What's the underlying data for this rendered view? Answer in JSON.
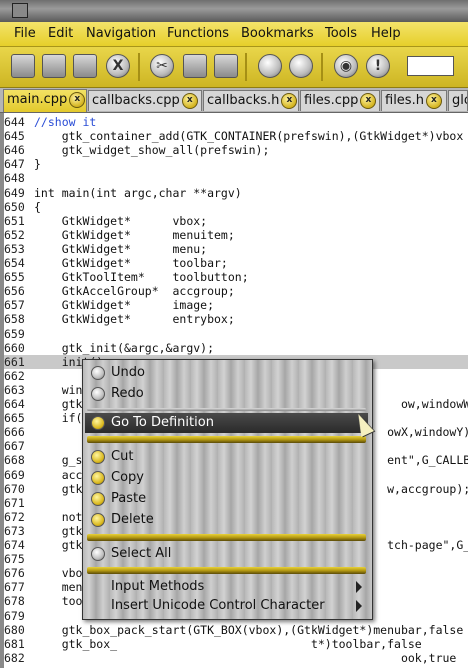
{
  "menubar": {
    "items": [
      "File",
      "Edit",
      "Navigation",
      "Functions",
      "Bookmarks",
      "Tools",
      "Help"
    ]
  },
  "toolbar": {
    "buttons": [
      "new-icon",
      "open-icon",
      "save-icon",
      "close-icon",
      "cut-icon",
      "copy-icon",
      "paste-icon",
      "back-icon",
      "forward-icon",
      "preview-icon",
      "help-icon"
    ],
    "search_value": ""
  },
  "tabs": [
    {
      "label": "main.cpp",
      "active": true
    },
    {
      "label": "callbacks.cpp",
      "active": false
    },
    {
      "label": "callbacks.h",
      "active": false
    },
    {
      "label": "files.cpp",
      "active": false
    },
    {
      "label": "files.h",
      "active": false
    },
    {
      "label": "glo",
      "active": false
    }
  ],
  "editor": {
    "current_line": "661",
    "lines": [
      {
        "n": "644",
        "t": "//show it"
      },
      {
        "n": "645",
        "t": "    gtk_container_add(GTK_CONTAINER(prefswin),(GtkWidget*)vbox"
      },
      {
        "n": "646",
        "t": "    gtk_widget_show_all(prefswin);"
      },
      {
        "n": "647",
        "t": "}"
      },
      {
        "n": "648",
        "t": ""
      },
      {
        "n": "649",
        "t": "int main(int argc,char **argv)"
      },
      {
        "n": "650",
        "t": "{"
      },
      {
        "n": "651",
        "t": "    GtkWidget*      vbox;"
      },
      {
        "n": "652",
        "t": "    GtkWidget*      menuitem;"
      },
      {
        "n": "653",
        "t": "    GtkWidget*      menu;"
      },
      {
        "n": "654",
        "t": "    GtkWidget*      toolbar;"
      },
      {
        "n": "655",
        "t": "    GtkToolItem*    toolbutton;"
      },
      {
        "n": "656",
        "t": "    GtkAccelGroup*  accgroup;"
      },
      {
        "n": "657",
        "t": "    GtkWidget*      image;"
      },
      {
        "n": "658",
        "t": "    GtkWidget*      entrybox;"
      },
      {
        "n": "659",
        "t": ""
      },
      {
        "n": "660",
        "t": "    gtk_init(&argc,&argv);"
      },
      {
        "n": "661",
        "t": "    init();"
      },
      {
        "n": "662",
        "t": ""
      },
      {
        "n": "663",
        "t": "    win"
      },
      {
        "n": "664",
        "t": "    gtk                                              ow,windowWidth"
      },
      {
        "n": "665",
        "t": "    if(                                            "
      },
      {
        "n": "666",
        "t": "                                                   owX,windowY);"
      },
      {
        "n": "667",
        "t": ""
      },
      {
        "n": "668",
        "t": "    g_s                                            ent\",G_CALLBAC"
      },
      {
        "n": "669",
        "t": "    acc"
      },
      {
        "n": "670",
        "t": "    gtk                                            w,accgroup);"
      },
      {
        "n": "671",
        "t": ""
      },
      {
        "n": "672",
        "t": "    not"
      },
      {
        "n": "673",
        "t": "    gtk"
      },
      {
        "n": "674",
        "t": "    gtk                                            tch-page\",G_CA"
      },
      {
        "n": "675",
        "t": ""
      },
      {
        "n": "676",
        "t": "    vbo"
      },
      {
        "n": "677",
        "t": "    menu"
      },
      {
        "n": "678",
        "t": "    too"
      },
      {
        "n": "679",
        "t": ""
      },
      {
        "n": "680",
        "t": "    gtk_box_pack_start(GTK_BOX(vbox),(GtkWidget*)menubar,false"
      },
      {
        "n": "681",
        "t": "    gtk_box_                            t*)toolbar,false"
      },
      {
        "n": "682",
        "t": "                                                     ook,true"
      }
    ]
  },
  "context_menu": {
    "items": [
      {
        "label": "Undo",
        "icon": "undo-icon"
      },
      {
        "label": "Redo",
        "icon": "redo-icon"
      },
      {
        "label": "Go To Definition",
        "icon": "goto-definition-icon"
      },
      {
        "label": "Cut",
        "icon": "cut-icon"
      },
      {
        "label": "Copy",
        "icon": "copy-icon"
      },
      {
        "label": "Paste",
        "icon": "paste-icon"
      },
      {
        "label": "Delete",
        "icon": "delete-icon"
      },
      {
        "label": "Select All",
        "icon": "select-all-icon"
      },
      {
        "label": "Input Methods",
        "icon": ""
      },
      {
        "label": "Insert Unicode Control Character",
        "icon": ""
      }
    ]
  },
  "colors": {
    "accent_yellow": "#e6cf2a",
    "keyword": "#3a3ad0",
    "string": "#c0282d",
    "comment": "#2a4dd6"
  }
}
